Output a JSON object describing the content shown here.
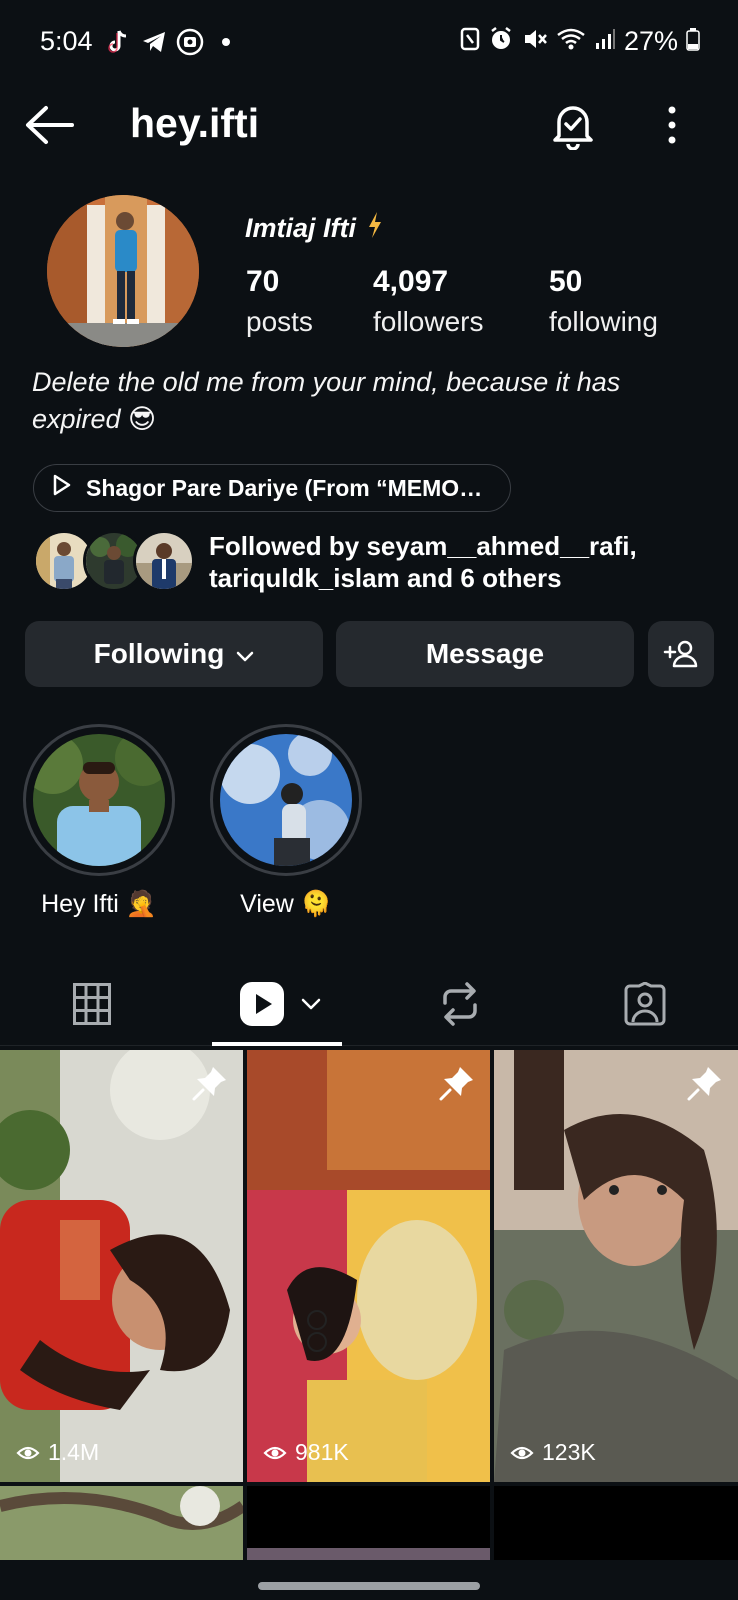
{
  "status_bar": {
    "time": "5:04",
    "battery": "27%"
  },
  "header": {
    "username": "hey.ifti"
  },
  "profile": {
    "display_name": "Imtiaj Ifti",
    "name_badge_icon": "lightning-icon",
    "stats": [
      {
        "value": "70",
        "label": "posts"
      },
      {
        "value": "4,097",
        "label": "followers"
      },
      {
        "value": "50",
        "label": "following"
      }
    ],
    "bio_line1": "Delete the old me from your mind, because it has",
    "bio_line2": "expired 😎",
    "music": "Shagor Pare Dariye (From “MEMO…",
    "followed_by_line1": "Followed by seyam__ahmed__rafi,",
    "followed_by_line2": "tariquldk_islam and 6 others"
  },
  "actions": {
    "following_label": "Following",
    "message_label": "Message"
  },
  "highlights": [
    {
      "label": "Hey Ifti 🤦"
    },
    {
      "label": "View 🫠"
    }
  ],
  "tabs": {
    "active": "reels"
  },
  "grid": [
    {
      "views": "1.4M",
      "pinned": true
    },
    {
      "views": "981K",
      "pinned": true
    },
    {
      "views": "123K",
      "pinned": true
    }
  ],
  "colors": {
    "background": "#0c1014",
    "button": "#25292e",
    "accent_badge": "#f5b942"
  }
}
